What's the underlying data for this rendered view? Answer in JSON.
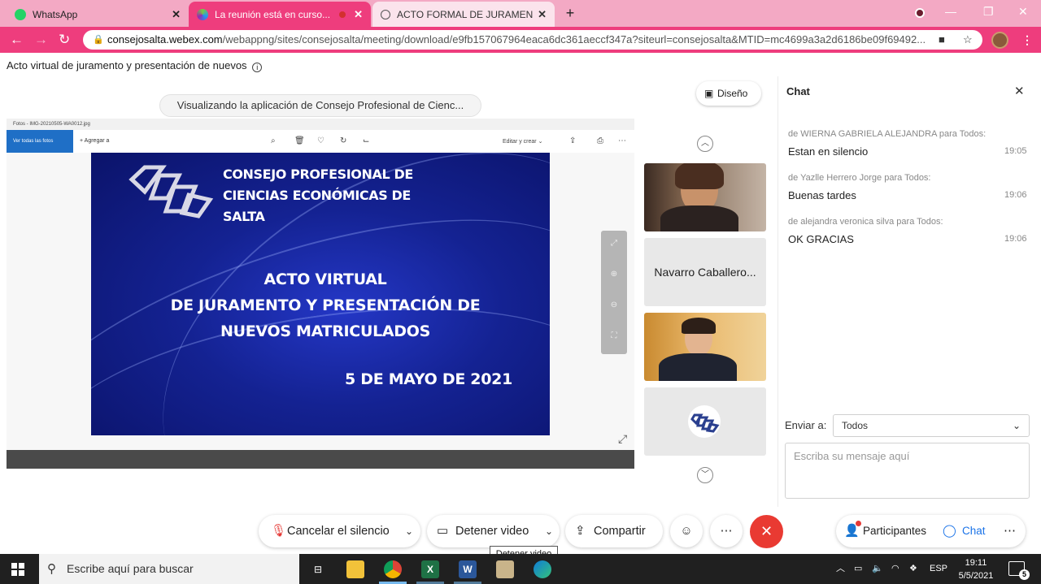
{
  "browser": {
    "tabs": [
      {
        "title": "WhatsApp"
      },
      {
        "title": "La reunión está en curso..."
      },
      {
        "title": "ACTO FORMAL DE JURAMENTO"
      }
    ],
    "url_domain": "consejosalta.webex.com",
    "url_path": "/webappng/sites/consejosalta/meeting/download/e9fb157067964eaca6dc361aeccf347a?siteurl=consejosalta&MTID=mc4699a3a2d6186be09f69492...",
    "colors": {
      "tabbar": "#f3a9c4",
      "active_tab": "#ee3d7d",
      "toolbar": "#ee3d7d"
    }
  },
  "meeting": {
    "title": "Acto virtual de juramento y presentación de nuevos",
    "sharing_label": "Visualizando la aplicación de Consejo Profesional de Cienc...",
    "layout_button": "Diseño"
  },
  "shared_window": {
    "title": "Fotos - IMG-20210505-WA0012.jpg",
    "view_all": "Ver todas las fotos",
    "add": "Agregar a",
    "edit_menu": "Editar y crear",
    "slide": {
      "org_line1": "CONSEJO PROFESIONAL DE",
      "org_line2": "CIENCIAS ECONÓMICAS DE",
      "org_line3": "SALTA",
      "act_line1": "ACTO VIRTUAL",
      "act_line2": "DE JURAMENTO Y PRESENTACIÓN DE",
      "act_line3": "NUEVOS MATRICULADOS",
      "date": "5 DE MAYO DE 2021"
    }
  },
  "participants": [
    {
      "type": "video"
    },
    {
      "type": "name",
      "name": "Navarro Caballero..."
    },
    {
      "type": "video"
    },
    {
      "type": "logo"
    }
  ],
  "chat": {
    "title": "Chat",
    "messages": [
      {
        "from": "de WIERNA GABRIELA ALEJANDRA para Todos:",
        "text": "Estan en silencio",
        "time": "19:05"
      },
      {
        "from": "de Yazlle Herrero Jorge para Todos:",
        "text": "Buenas tardes",
        "time": "19:06"
      },
      {
        "from": "de alejandra veronica silva para Todos:",
        "text": "OK GRACIAS",
        "time": "19:06"
      }
    ],
    "send_to_label": "Enviar a:",
    "send_to_value": "Todos",
    "input_placeholder": "Escriba su mensaje aquí"
  },
  "controls": {
    "unmute": "Cancelar el silencio",
    "stop_video": "Detener video",
    "share": "Compartir",
    "participants": "Participantes",
    "chat": "Chat",
    "tooltip": "Detener video",
    "end_color": "#e93a32"
  },
  "taskbar": {
    "search_placeholder": "Escribe aquí para buscar",
    "lang": "ESP",
    "time": "19:11",
    "date": "5/5/2021",
    "notifications": "5"
  }
}
